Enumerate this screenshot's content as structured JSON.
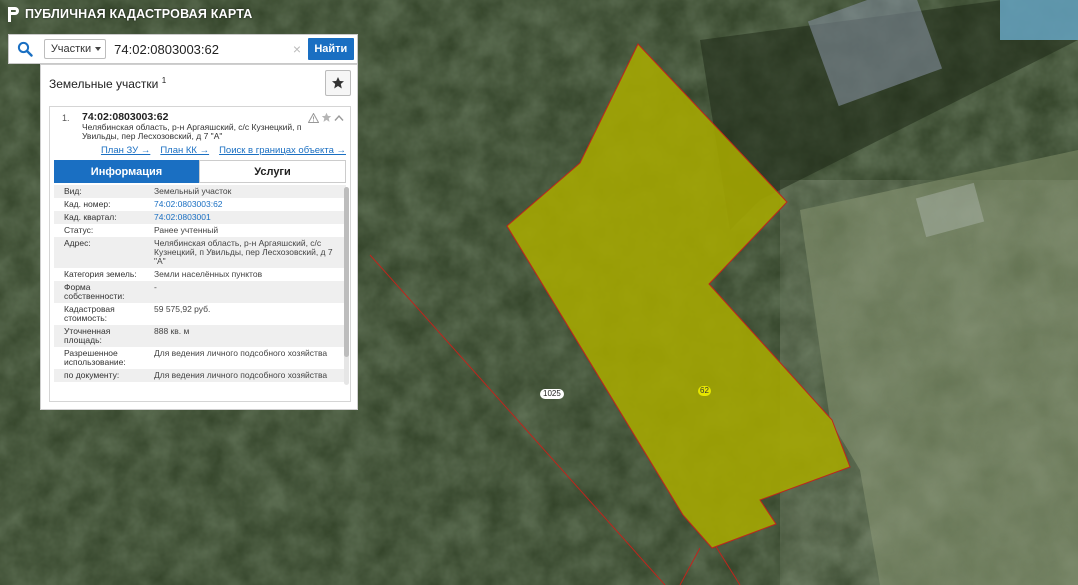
{
  "app": {
    "title": "ПУБЛИЧНАЯ КАДАСТРОВАЯ КАРТА"
  },
  "search": {
    "type_label": "Участки",
    "query": "74:02:0803003:62",
    "find_label": "Найти"
  },
  "panel": {
    "title": "Земельные участки",
    "count": "1",
    "item": {
      "index": "1.",
      "cad_number": "74:02:0803003:62",
      "address": "Челябинская область, р-н Аргаяшский, с/с Кузнецкий, п Увильды, пер Лесхозовский, д 7 \"А\"",
      "links": [
        "План ЗУ →",
        "План КК →",
        "Поиск в границах объекта →"
      ]
    },
    "tabs": [
      "Информация",
      "Услуги"
    ],
    "fields": [
      {
        "k": "Вид:",
        "v": "Земельный участок"
      },
      {
        "k": "Кад. номер:",
        "v": "74:02:0803003:62"
      },
      {
        "k": "Кад. квартал:",
        "v": "74:02:0803001"
      },
      {
        "k": "Статус:",
        "v": "Ранее учтенный"
      },
      {
        "k": "Адрес:",
        "v": "Челябинская область, р-н Аргаяшский, с/с Кузнецкий, п Увильды, пер Лесхозовский, д 7 \"А\""
      },
      {
        "k": "Категория земель:",
        "v": "Земли населённых пунктов"
      },
      {
        "k": "Форма собственности:",
        "v": "-"
      },
      {
        "k": "Кадастровая стоимость:",
        "v": "59 575,92 руб."
      },
      {
        "k": "Уточненная площадь:",
        "v": "888 кв. м"
      },
      {
        "k": "Разрешенное использование:",
        "v": "Для ведения личного подсобного хозяйства"
      },
      {
        "k": "по документу:",
        "v": "Для ведения личного подсобного хозяйства"
      }
    ]
  },
  "map": {
    "parcel_label": "62",
    "line_label": "1025",
    "parcel_color": "#a6a800"
  }
}
